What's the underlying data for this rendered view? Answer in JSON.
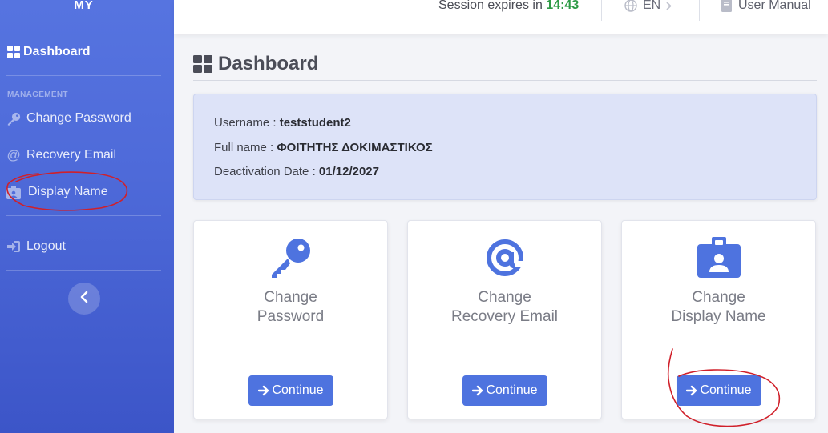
{
  "brand": "MY",
  "sidebar": {
    "dashboard_label": "Dashboard",
    "heading": "MANAGEMENT",
    "items": [
      {
        "label": "Change Password",
        "icon": "key-icon"
      },
      {
        "label": "Recovery Email",
        "icon": "at-icon"
      },
      {
        "label": "Display Name",
        "icon": "id-badge-icon"
      }
    ],
    "logout_label": "Logout",
    "toggle_icon": "chevron-left-icon"
  },
  "topbar": {
    "session_text": "Session expires in",
    "session_time": "14:43",
    "language": "EN",
    "manual_label": "User Manual"
  },
  "page": {
    "title": "Dashboard"
  },
  "info": {
    "username_label": "Username :",
    "username": "teststudent2",
    "fullname_label": "Full name :",
    "fullname": "ΦΟΙΤΗΤΗΣ ΔΟΚΙΜΑΣΤΙΚΟΣ",
    "deactivation_label": "Deactivation Date :",
    "deactivation_date": "01/12/2027"
  },
  "cards": [
    {
      "line1": "Change",
      "line2": "Password",
      "button": "Continue",
      "icon": "key-icon"
    },
    {
      "line1": "Change",
      "line2": "Recovery Email",
      "button": "Continue",
      "icon": "at-icon"
    },
    {
      "line1": "Change",
      "line2": "Display Name",
      "button": "Continue",
      "icon": "id-badge-icon"
    }
  ],
  "colors": {
    "accent": "#4e73df",
    "sidebar": "#4e6ad9",
    "session_time": "#2e9b46",
    "annotation": "#d0202a"
  }
}
